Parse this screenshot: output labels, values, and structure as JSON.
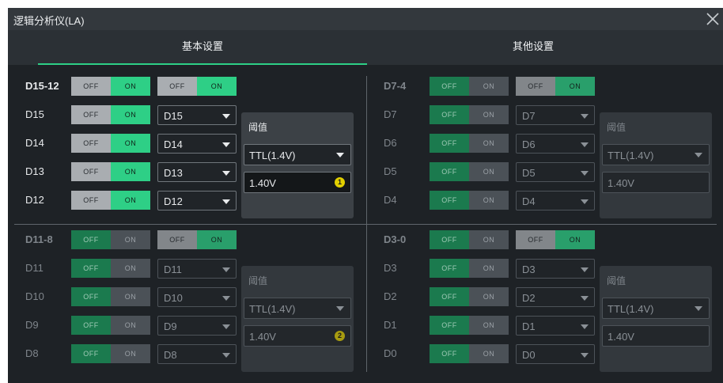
{
  "window": {
    "title": "逻辑分析仪(LA)"
  },
  "tabs": [
    {
      "label": "基本设置"
    },
    {
      "label": "其他设置"
    }
  ],
  "toggle": {
    "off": "OFF",
    "on": "ON"
  },
  "threshold_label": "阈值",
  "groups": [
    {
      "name": "D15-12",
      "group_a": "on",
      "group_b": "on",
      "threshold_type": "TTL(1.4V)",
      "threshold_value": "1.40V",
      "badge": "1",
      "channels": [
        {
          "label": "D15",
          "state": "on",
          "source": "D15"
        },
        {
          "label": "D14",
          "state": "on",
          "source": "D14"
        },
        {
          "label": "D13",
          "state": "on",
          "source": "D13"
        },
        {
          "label": "D12",
          "state": "on",
          "source": "D12"
        }
      ]
    },
    {
      "name": "D7-4",
      "group_a": "off",
      "group_b": "on",
      "threshold_type": "TTL(1.4V)",
      "threshold_value": "1.40V",
      "badge": "",
      "channels": [
        {
          "label": "D7",
          "state": "off",
          "source": "D7"
        },
        {
          "label": "D6",
          "state": "off",
          "source": "D6"
        },
        {
          "label": "D5",
          "state": "off",
          "source": "D5"
        },
        {
          "label": "D4",
          "state": "off",
          "source": "D4"
        }
      ]
    },
    {
      "name": "D11-8",
      "group_a": "off",
      "group_b": "on",
      "threshold_type": "TTL(1.4V)",
      "threshold_value": "1.40V",
      "badge": "2",
      "channels": [
        {
          "label": "D11",
          "state": "off",
          "source": "D11"
        },
        {
          "label": "D10",
          "state": "off",
          "source": "D10"
        },
        {
          "label": "D9",
          "state": "off",
          "source": "D9"
        },
        {
          "label": "D8",
          "state": "off",
          "source": "D8"
        }
      ]
    },
    {
      "name": "D3-0",
      "group_a": "off",
      "group_b": "on",
      "threshold_type": "TTL(1.4V)",
      "threshold_value": "1.40V",
      "badge": "",
      "channels": [
        {
          "label": "D3",
          "state": "off",
          "source": "D3"
        },
        {
          "label": "D2",
          "state": "off",
          "source": "D2"
        },
        {
          "label": "D1",
          "state": "off",
          "source": "D1"
        },
        {
          "label": "D0",
          "state": "off",
          "source": "D0"
        }
      ]
    }
  ],
  "colors": {
    "accent": "#2ecf86",
    "toggle_off_active": "#1f8a58",
    "background": "#1e2226",
    "badge": "#e2d000"
  }
}
